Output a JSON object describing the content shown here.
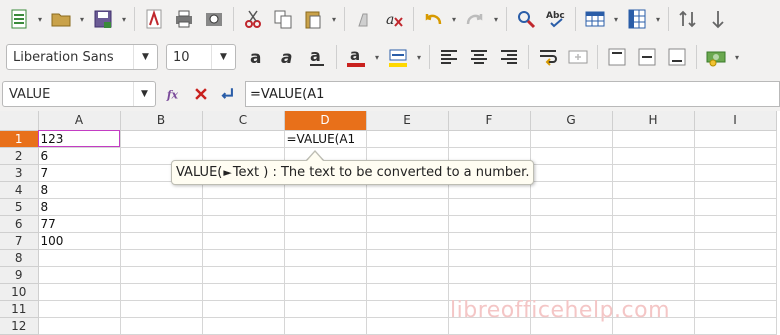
{
  "toolbar2": {
    "font_name": "Liberation Sans",
    "font_size": "10"
  },
  "formula_bar": {
    "name_box": "VALUE",
    "input": "=VALUE(A1"
  },
  "sheet": {
    "columns": [
      "A",
      "B",
      "C",
      "D",
      "E",
      "F",
      "G",
      "H",
      "I"
    ],
    "active_column": "D",
    "rows": [
      "1",
      "2",
      "3",
      "4",
      "5",
      "6",
      "7",
      "8",
      "9",
      "10",
      "11",
      "12"
    ],
    "active_row": "1",
    "colA": [
      "123",
      "6",
      "7",
      "8",
      "8",
      "77",
      "100",
      "",
      "",
      "",
      "",
      ""
    ],
    "d1": "=VALUE(A1"
  },
  "tooltip": {
    "text_prefix": "VALUE(",
    "text_suffix": " Text ) : The text to be converted to a number."
  },
  "watermark": "libreofficehelp.com",
  "colors": {
    "accent_active": "#e8701a",
    "reference_outline": "#c33dc3"
  }
}
